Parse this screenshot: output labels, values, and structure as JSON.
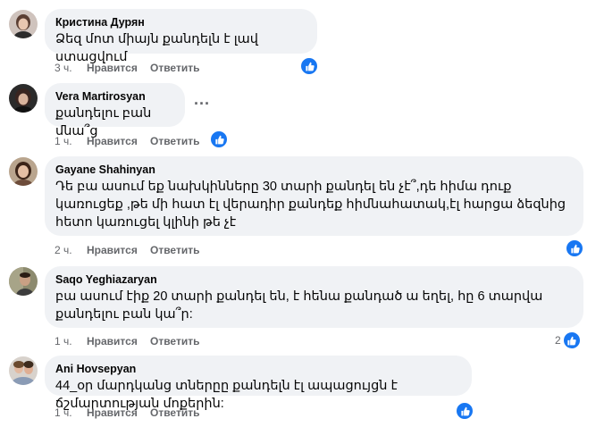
{
  "colors": {
    "accent": "#1877f2",
    "bubble": "#f0f2f5",
    "meta": "#65676b"
  },
  "comments": [
    {
      "author": "Кристина Дурян",
      "text": "Ձեզ մոտ միայն քանդելն է լավ ստացվում",
      "time": "3 ч.",
      "like_label": "Нравится",
      "reply_label": "Ответить",
      "reaction_icon": "like-icon",
      "reaction_count": ""
    },
    {
      "author": "Vera Martirosyan",
      "text": "քանդելու բան մնա՞ց",
      "time": "1 ч.",
      "like_label": "Нравится",
      "reply_label": "Ответить",
      "reaction_icon": "like-icon",
      "reaction_count": "",
      "more_icon": "···"
    },
    {
      "author": "Gayane Shahinyan",
      "text": "Դե բա ասում եք նախկինները 30 տարի քանդել են չէ՞,դե հիմա դուք կառուցեք ,թե մի հատ էլ վերադիր քանդեք հիմնահատակ,էլ հարցա ձեզնից հետո կառուցել կլինի թե չէ",
      "time": "2 ч.",
      "like_label": "Нравится",
      "reply_label": "Ответить",
      "reaction_icon": "like-icon",
      "reaction_count": ""
    },
    {
      "author": "Saqo Yeghiazaryan",
      "text": "բա ասում էիք 20 տարի քանդել են, է հենա քանդած ա եղել, հը 6 տարվա քանդելու բան կա՞ր:",
      "time": "1 ч.",
      "like_label": "Нравится",
      "reply_label": "Ответить",
      "reaction_icon": "like-icon",
      "reaction_count": "2"
    },
    {
      "author": "Ani Hovsepyan",
      "text": "44_օր մարդկանց տներըը քանդելն էլ ապացույցն է ճշմարտության մոքերին:",
      "time": "1 ч.",
      "like_label": "Нравится",
      "reply_label": "Ответить",
      "reaction_icon": "like-icon",
      "reaction_count": ""
    }
  ]
}
